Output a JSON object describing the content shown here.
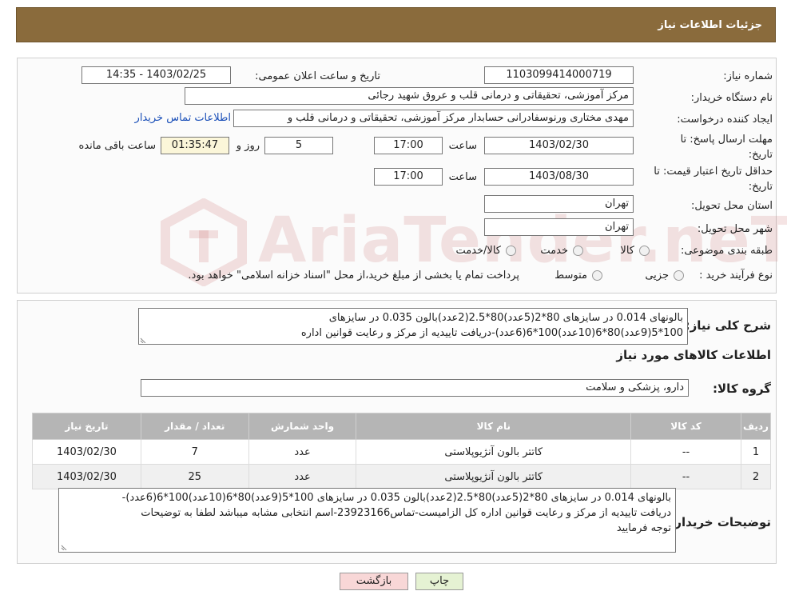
{
  "header": {
    "title": "جزئیات اطلاعات نیاز"
  },
  "info": {
    "need_number_label": "شماره نیاز:",
    "need_number": "1103099414000719",
    "announce_label": "تاریخ و ساعت اعلان عمومی:",
    "announce_value": "1403/02/25 - 14:35",
    "buyer_org_label": "نام دستگاه خریدار:",
    "buyer_org": "مرکز آموزشی، تحقیقاتی و درمانی قلب و عروق شهید رجائی",
    "creator_label": "ایجاد کننده درخواست:",
    "creator": "مهدی مختاری ورنوسفادرانی حسابدار مرکز آموزشی، تحقیقاتی و درمانی قلب و",
    "contact_link": "اطلاعات تماس خریدار",
    "deadline_label_1": "مهلت ارسال پاسخ: تا",
    "deadline_label_2": "تاریخ:",
    "deadline_date": "1403/02/30",
    "time_label": "ساعت",
    "deadline_time": "17:00",
    "days_value": "5",
    "days_label": "روز و",
    "remaining_time": "01:35:47",
    "remaining_label": "ساعت باقی مانده",
    "validity_label_1": "حداقل تاریخ اعتبار قیمت: تا",
    "validity_label_2": "تاریخ:",
    "validity_date": "1403/08/30",
    "validity_time": "17:00",
    "province_label": "استان محل تحویل:",
    "province": "تهران",
    "city_label": "شهر محل تحویل:",
    "city": "تهران",
    "category_label": "طبقه بندی موضوعی:",
    "category_options": [
      "کالا",
      "خدمت",
      "کالا/خدمت"
    ],
    "process_label": "نوع فرآیند خرید :",
    "process_options": [
      "جزیی",
      "متوسط"
    ],
    "process_note": "پرداخت تمام یا بخشی از مبلغ خرید،از محل \"اسناد خزانه اسلامی\" خواهد بود."
  },
  "summary": {
    "label": "شرح کلی نیاز:",
    "line1": "بالونهای 0.014 در سایزهای 80*2(5عدد)80*2.5(2عدد)بالون 0.035 در سایزهای",
    "line2": "100*5(9عدد)80*6(10عدد)100*6(6عدد)-دریافت تاییدیه از مرکز و رعایت قوانین اداره"
  },
  "goods": {
    "title": "اطلاعات کالاهای مورد نیاز",
    "group_label": "گروه کالا:",
    "group_value": "دارو، پزشکی و سلامت"
  },
  "table": {
    "headers": [
      "ردیف",
      "کد کالا",
      "نام کالا",
      "واحد شمارش",
      "تعداد / مقدار",
      "تاریخ نیاز"
    ],
    "rows": [
      [
        "1",
        "--",
        "کاتتر بالون آنژیوپلاستی",
        "عدد",
        "7",
        "1403/02/30"
      ],
      [
        "2",
        "--",
        "کاتتر بالون آنژیوپلاستی",
        "عدد",
        "25",
        "1403/02/30"
      ]
    ]
  },
  "buyer_notes": {
    "label": "توضیحات خریدار:",
    "line1": "بالونهای 0.014 در سایزهای 80*2(5عدد)80*2.5(2عدد)بالون 0.035 در سایزهای 100*5(9عدد)80*6(10عدد)100*6(6عدد)-",
    "line2": "دریافت تاییدیه از مرکز و رعایت قوانین اداره کل الزامیست-تماس23923166-اسم انتخابی مشابه میباشد لطفا به توضیحات",
    "line3": "توجه فرمایید"
  },
  "buttons": {
    "print": "چاپ",
    "back": "بازگشت"
  },
  "watermark": {
    "text": "AriaTender.neT",
    "icon": "ariatender-logo-icon"
  },
  "colors": {
    "header_bg": "#8a6b3c",
    "link": "#1a4fb8",
    "back_bg": "#f8d7d7",
    "print_bg": "#e5f2d3"
  }
}
